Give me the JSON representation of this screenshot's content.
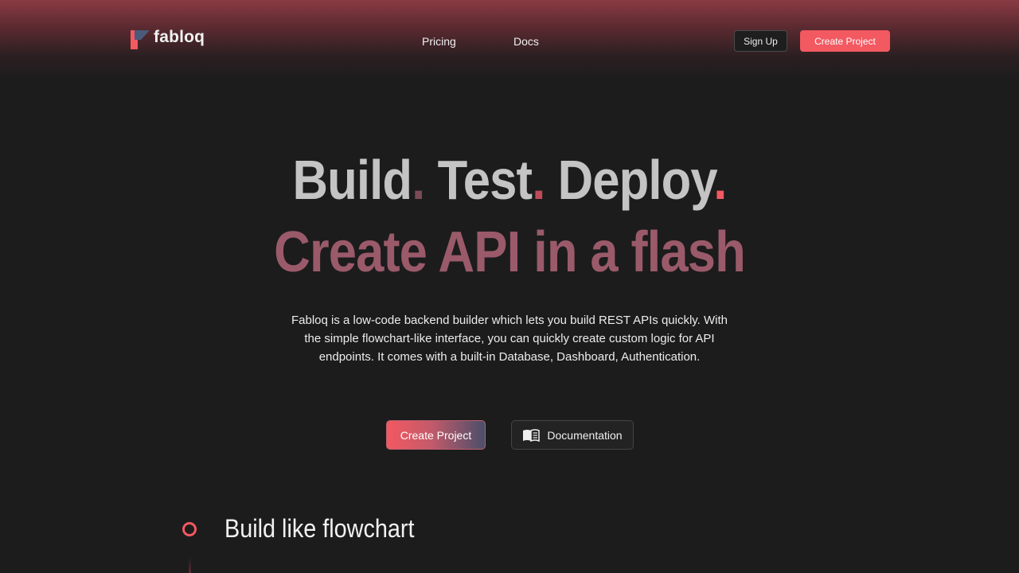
{
  "nav": {
    "logo_text": "fabloq",
    "links": [
      "Pricing",
      "Docs"
    ],
    "signup_label": "Sign Up",
    "create_label": "Create Project"
  },
  "hero": {
    "line1_words": [
      "Build",
      "Test",
      "Deploy"
    ],
    "dot": ".",
    "line2": "Create API in a flash",
    "description": "Fabloq is a low-code backend builder which lets you build REST APIs quickly. With the simple flowchart-like interface, you can quickly create custom logic for API endpoints. It comes with a built-in Database, Dashboard, Authentication.",
    "primary_cta": "Create Project",
    "secondary_cta": "Documentation",
    "secondary_icon": "book-icon"
  },
  "features": {
    "first_title": "Build like flowchart",
    "marker_icon": "circle-icon"
  },
  "colors": {
    "accent": "#f25961",
    "background": "#1c1c1d",
    "headline": "#c4c4c4",
    "subheadline": "#9a5a6a"
  }
}
